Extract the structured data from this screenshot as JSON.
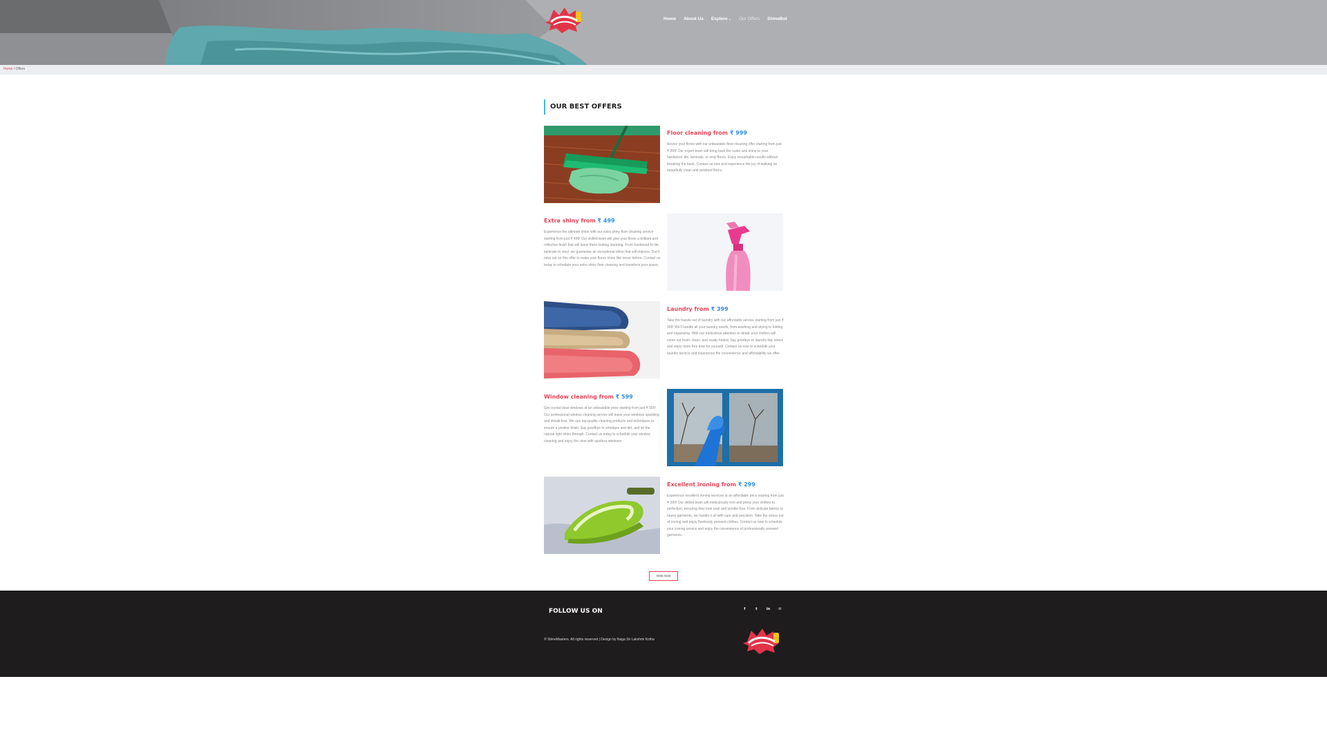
{
  "nav": {
    "items": [
      {
        "label": "Home"
      },
      {
        "label": "About Us"
      },
      {
        "label": "Explore"
      },
      {
        "label": "Our Offers"
      },
      {
        "label": "ShineBot"
      }
    ]
  },
  "breadcrumb": {
    "home": "Home",
    "separator": "/",
    "current": "Offers"
  },
  "main": {
    "title": "OUR BEST OFFERS",
    "offers": [
      {
        "title": "Floor cleaning from",
        "price": "₹ 999",
        "description": "Revive your floors with our unbeatable floor cleaning offer starting from just ₹ 999! Our expert team will bring back the luster and shine to your hardwood, tile, laminate, or vinyl floors. Enjoy remarkable results without breaking the bank. Contact us now and experience the joy of walking on beautifully clean and polished floors."
      },
      {
        "title": "Extra shiny from",
        "price": "₹ 499",
        "description": "Experience the ultimate shine with our extra shiny floor cleaning service starting from just ₹ 499! Our skilled team will give your floors a brilliant and reflective finish that will leave them looking stunning. From hardwood to tile, laminate to vinyl, we guarantee an exceptional shine that will impress. Don't miss out on this offer to make your floors shine like never before. Contact us today to schedule your extra shiny floor cleaning and transform your space."
      },
      {
        "title": "Laundry from",
        "price": "₹ 399",
        "description": "Take the hassle out of laundry with our affordable service starting from just ₹ 399! We'll handle all your laundry needs, from washing and drying to folding and organizing. With our meticulous attention to detail, your clothes will come out fresh, clean, and neatly folded. Say goodbye to laundry day stress and enjoy more free time for yourself. Contact us now to schedule your laundry service and experience the convenience and affordability we offer."
      },
      {
        "title": "Window cleaning from",
        "price": "₹ 599",
        "description": "Get crystal-clear windows at an unbeatable price starting from just ₹ 599! Our professional window cleaning service will leave your windows sparkling and streak-free. We use top-quality cleaning products and techniques to ensure a pristine finish. Say goodbye to smudges and dirt, and let the natural light shine through. Contact us today to schedule your window cleaning and enjoy the view with spotless windows."
      },
      {
        "title": "Excellent ironing from",
        "price": "₹ 299",
        "description": "Experience excellent ironing services at an affordable price starting from just ₹ 299! Our skilled team will meticulously iron and press your clothes to perfection, ensuring they look neat and wrinkle-free. From delicate fabrics to heavy garments, we handle it all with care and precision. Take the stress out of ironing and enjoy flawlessly pressed clothes. Contact us now to schedule your ironing service and enjoy the convenience of professionally pressed garments."
      }
    ],
    "view_more": "View more"
  },
  "footer": {
    "follow": "FOLLOW US ON",
    "social": [
      "f",
      "t",
      "in",
      "✉"
    ],
    "copyright": "© ShineMasters. All rights reserved | Design by Naga Sri Lakshmi Kotha"
  },
  "colors": {
    "accent": "#e8445a",
    "price": "#2e8fe0",
    "title_bar": "#3fb7e8",
    "footer_bg": "#1e1c1d"
  }
}
